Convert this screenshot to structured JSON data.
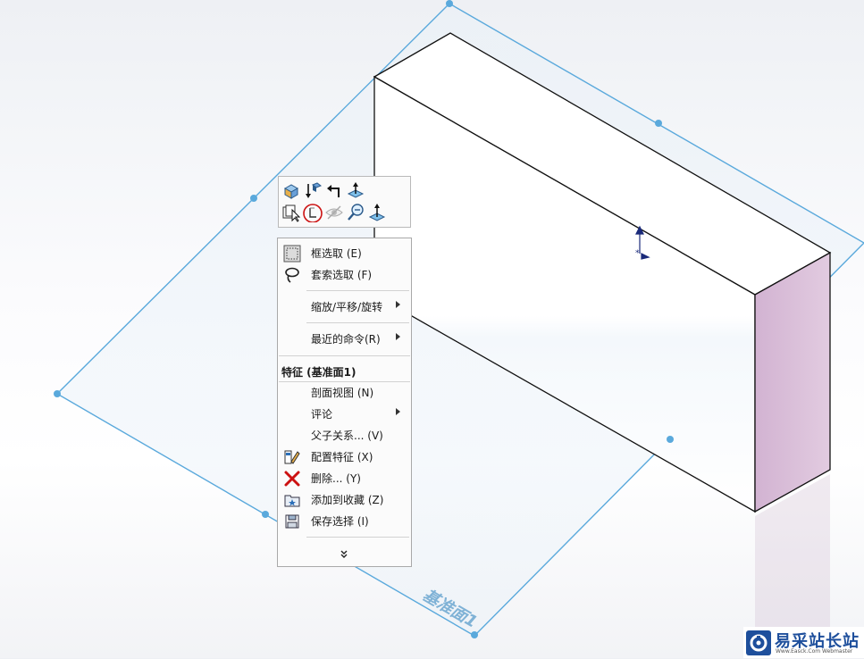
{
  "plane_label": "基准面1",
  "mini_toolbar": {
    "buttons": [
      {
        "name": "view-orientation-icon"
      },
      {
        "name": "normal-to-icon"
      },
      {
        "name": "rollback-icon"
      },
      {
        "name": "move-plane-icon"
      },
      {
        "name": "select-other-icon"
      },
      {
        "name": "sketch-icon"
      },
      {
        "name": "hide-show-icon"
      },
      {
        "name": "zoom-to-selection-icon"
      },
      {
        "name": "normal-to-plane-icon"
      }
    ]
  },
  "context_menu": {
    "box_select": "框选取 (E)",
    "lasso_select": "套索选取 (F)",
    "zoom_pan_rotate": "缩放/平移/旋转",
    "recent_commands": "最近的命令(R)",
    "section_title": "特征 (基准面1)",
    "section_view": "剖面视图 (N)",
    "comment": "评论",
    "parent_child": "父子关系... (V)",
    "configure_feature": "配置特征 (X)",
    "delete": "删除... (Y)",
    "add_to_favorites": "添加到收藏 (Z)",
    "save_selection": "保存选择 (I)",
    "more_symbol": "»"
  },
  "watermark": {
    "title": "易采站长站",
    "subtitle": "Www.Easck.Com Webmaster"
  },
  "colors": {
    "plane_edge": "#5aa9dc",
    "box_side": "#d9c1da",
    "selection_highlight": "#cc0000"
  }
}
